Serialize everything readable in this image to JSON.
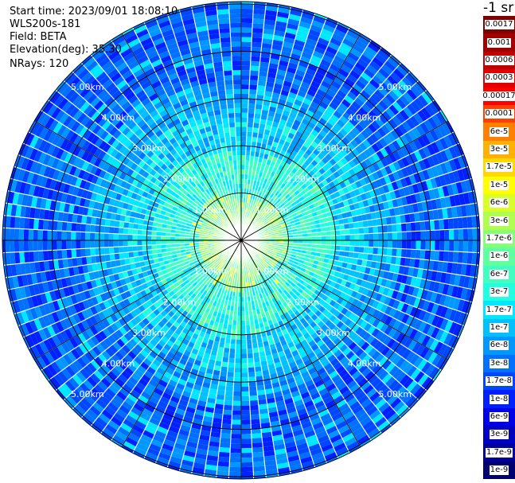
{
  "info": {
    "start_time": "Start time: 2023/09/01 18:08:10",
    "instrument": "WLS200s-181",
    "field": "Field: BETA",
    "elevation": "Elevation(deg): 35.30",
    "nrays": "NRays: 120"
  },
  "colorbar": {
    "title": "-1 sr",
    "labels": [
      "0.0017",
      "0.001",
      "0.0006",
      "0.0003",
      "0.00017",
      "0.0001",
      "6e-5",
      "3e-5",
      "1.7e-5",
      "1e-5",
      "6e-6",
      "3e-6",
      "1.7e-6",
      "1e-6",
      "6e-7",
      "3e-7",
      "1.7e-7",
      "1e-7",
      "6e-8",
      "3e-8",
      "1.7e-8",
      "1e-8",
      "6e-9",
      "3e-9",
      "1.7e-9",
      "1e-9"
    ],
    "colors": [
      "#800000",
      "#a00000",
      "#c00000",
      "#e00000",
      "#ff0000",
      "#ff4000",
      "#ff8000",
      "#ffb000",
      "#ffd800",
      "#ffff00",
      "#d8ff28",
      "#b0ff50",
      "#88ff78",
      "#60ffa0",
      "#40ffc0",
      "#20ffe0",
      "#00e8ff",
      "#00c0ff",
      "#0098ff",
      "#0070ff",
      "#0048ff",
      "#0020ff",
      "#0000e8",
      "#0000c0",
      "#000098",
      "#000070"
    ]
  },
  "chart_data": {
    "type": "ppi",
    "field": "BETA",
    "nrays": 120,
    "elevation_deg": 35.3,
    "range_rings_km": [
      1,
      2,
      3,
      4,
      5
    ],
    "ring_labels": [
      "1.00km",
      "2.00km",
      "3.00km",
      "4.00km",
      "5.00km"
    ],
    "max_range_km": 5.0,
    "spokes_deg": [
      0,
      30,
      60,
      90,
      120,
      150
    ],
    "value_bands": [
      {
        "from_km": 0.0,
        "to_km": 1.0,
        "level": "1.7e-6 to 1e-5"
      },
      {
        "from_km": 1.0,
        "to_km": 2.0,
        "level": "1.7e-7 to 1.7e-6"
      },
      {
        "from_km": 2.0,
        "to_km": 3.0,
        "level": "3e-8 to 1.7e-7"
      },
      {
        "from_km": 3.0,
        "to_km": 5.0,
        "level": "1e-8 to 3e-8"
      }
    ]
  }
}
